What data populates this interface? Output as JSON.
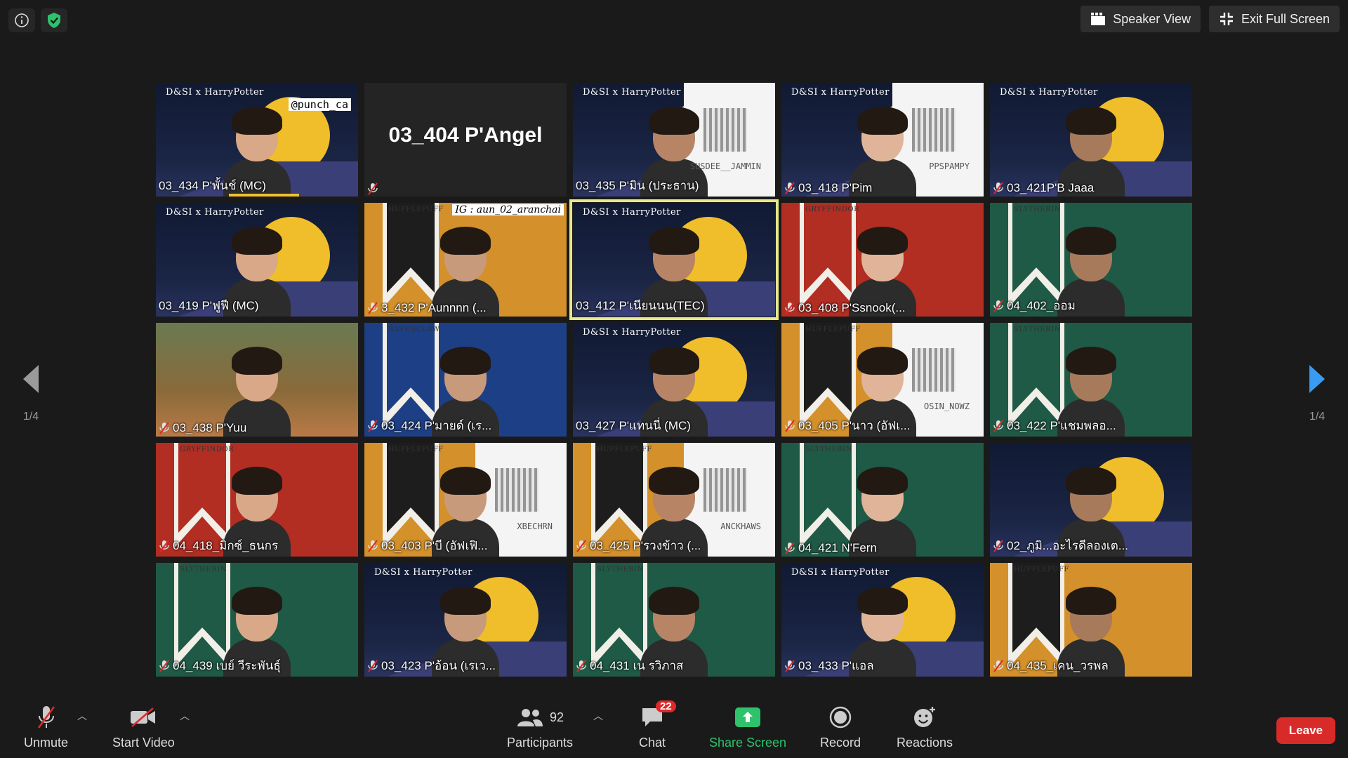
{
  "top": {
    "speaker_view_label": "Speaker View",
    "exit_full_screen_label": "Exit Full Screen"
  },
  "nav": {
    "left_page": "1/4",
    "right_page": "1/4"
  },
  "tiles": [
    {
      "name": "03_434 P'พั้นช์ (MC)",
      "bg": "night",
      "muted": false,
      "brand": "D&SI x HarryPotter",
      "handle": "@punch_ca",
      "speaking": true
    },
    {
      "name": "03_404 P'Angel",
      "bg": "blank",
      "muted": true,
      "big": "03_404 P'Angel"
    },
    {
      "name": "03_435 P'มิน (ประธาน)",
      "bg": "night",
      "muted": false,
      "brand": "D&SI x HarryPotter",
      "qr": "SUSDEE__JAMMIN"
    },
    {
      "name": "03_418 P'Pim",
      "bg": "night",
      "muted": true,
      "brand": "D&SI x HarryPotter",
      "qr": "PPSPAMPY"
    },
    {
      "name": "03_421P'B Jaaa",
      "bg": "night",
      "muted": true,
      "brand": "D&SI x HarryPotter"
    },
    {
      "name": "03_419 P'ฟูฟี (MC)",
      "bg": "night",
      "muted": false,
      "brand": "D&SI x HarryPotter"
    },
    {
      "name": "3_432 P'Aunnnn (...",
      "bg": "hufflepuff",
      "muted": true,
      "house": "HUFFLEPUFF",
      "ig": "IG : aun_02_aranchai"
    },
    {
      "name": "03_412 P'เนียนนน(TEC)",
      "bg": "night",
      "muted": false,
      "brand": "D&SI x HarryPotter",
      "active": true
    },
    {
      "name": "03_408 P'Ssnook(...",
      "bg": "gryffindor",
      "muted": true,
      "house": "GRYFFINDOR"
    },
    {
      "name": "04_402_ออม",
      "bg": "slytherin",
      "muted": true,
      "house": "SLYTHERIN"
    },
    {
      "name": "03_438 P'Yuu",
      "bg": "forest",
      "muted": true
    },
    {
      "name": "03_424 P'มายด์ (เร...",
      "bg": "ravenclaw",
      "muted": true,
      "house": "RAVENCLAW"
    },
    {
      "name": "03_427 P'แทนนี่ (MC)",
      "bg": "night",
      "muted": false,
      "brand": "D&SI x HarryPotter"
    },
    {
      "name": "03_405 P'นาว (อัฟเ...",
      "bg": "hufflepuff",
      "muted": true,
      "house": "HUFFLEPUFF",
      "qr": "OSIN_NOWZ"
    },
    {
      "name": "03_422 P'แชมพลอ...",
      "bg": "slytherin",
      "muted": true,
      "house": "SLYTHERIN"
    },
    {
      "name": "04_418_มิกซ์_ธนกร",
      "bg": "gryffindor",
      "muted": true,
      "house": "GRYFFINDOR"
    },
    {
      "name": "03_403 P'บี (อัฟเฟิ...",
      "bg": "hufflepuff",
      "muted": true,
      "house": "HUFFLEPUFF",
      "qr": "XBECHRN"
    },
    {
      "name": "03_425 P'รวงข้าว (...",
      "bg": "hufflepuff",
      "muted": true,
      "house": "HUFFLEPUFF",
      "qr": "ANCKHAWS"
    },
    {
      "name": "04_421 N'Fern",
      "bg": "slytherin",
      "muted": true,
      "house": "SLYTHERIN"
    },
    {
      "name": "02_ภูมิ...อะไรดีลองเต...",
      "bg": "night",
      "muted": true
    },
    {
      "name": "04_439 เบย์ วีระพันธุ์",
      "bg": "slytherin",
      "muted": true,
      "house": "SLYTHERIN"
    },
    {
      "name": "03_423 P'อ้อน (เรเว...",
      "bg": "night",
      "muted": true,
      "brand": "D&SI x HarryPotter"
    },
    {
      "name": "04_431 เน รวิภาส",
      "bg": "slytherin",
      "muted": true,
      "house": "SLYTHERIN"
    },
    {
      "name": "03_433 P'แอล",
      "bg": "night",
      "muted": true,
      "brand": "D&SI x HarryPotter"
    },
    {
      "name": "04_435_เคน_วรพล",
      "bg": "hufflepuff",
      "muted": true,
      "house": "HUFFLEPUFF"
    }
  ],
  "toolbar": {
    "unmute_label": "Unmute",
    "start_video_label": "Start Video",
    "participants_label": "Participants",
    "participants_count": "92",
    "chat_label": "Chat",
    "chat_badge": "22",
    "share_screen_label": "Share Screen",
    "record_label": "Record",
    "reactions_label": "Reactions",
    "leave_label": "Leave"
  },
  "colors": {
    "accent_green": "#2dc26b",
    "leave_red": "#d92a2a",
    "active_outline": "#e6e88a",
    "moon": "#f0be2a"
  }
}
